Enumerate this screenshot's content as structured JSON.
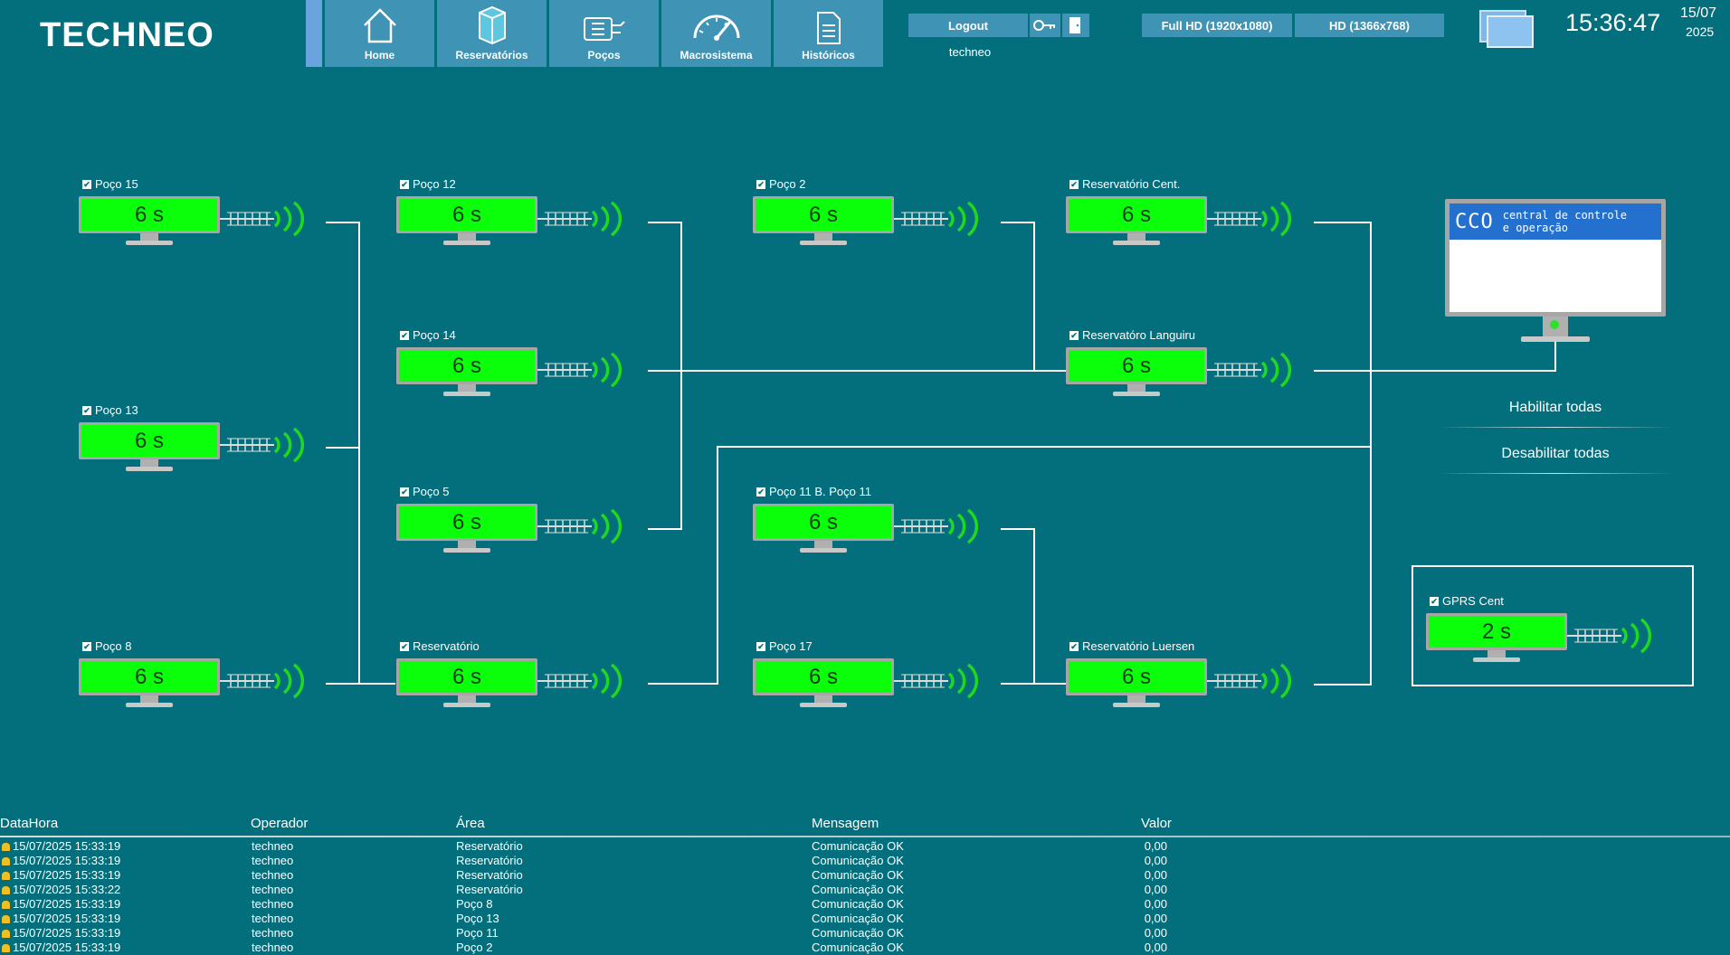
{
  "app": {
    "logo": "TECHNEO"
  },
  "nav": [
    {
      "label": "Home",
      "icon": "home-icon"
    },
    {
      "label": "Reservatórios",
      "icon": "tank-icon"
    },
    {
      "label": "Poços",
      "icon": "pump-icon"
    },
    {
      "label": "Macrosistema",
      "icon": "gauge-icon"
    },
    {
      "label": "Históricos",
      "icon": "document-icon"
    }
  ],
  "header": {
    "logout_label": "Logout",
    "user": "techneo",
    "res_full_hd": "Full HD (1920x1080)",
    "res_hd": "HD (1366x768)",
    "time": "15:36:47",
    "date_day": "15/07",
    "date_year": "2025"
  },
  "nodes": [
    {
      "name": "Poço 15",
      "value": "6 s"
    },
    {
      "name": "Poço 13",
      "value": "6 s"
    },
    {
      "name": "Poço 8",
      "value": "6 s"
    },
    {
      "name": "Poço 12",
      "value": "6 s"
    },
    {
      "name": "Poço 14",
      "value": "6 s"
    },
    {
      "name": "Poço 5",
      "value": "6 s"
    },
    {
      "name": "Reservatório",
      "value": "6 s"
    },
    {
      "name": "Poço 2",
      "value": "6 s"
    },
    {
      "name": "Poço 11 B. Poço 11",
      "value": "6 s"
    },
    {
      "name": "Poço 17",
      "value": "6 s"
    },
    {
      "name": "Reservatório Cent.",
      "value": "6 s"
    },
    {
      "name": "Reservatóro Languiru",
      "value": "6 s"
    },
    {
      "name": "Reservatório Luersen",
      "value": "6 s"
    },
    {
      "name": "GPRS Cent",
      "value": "2 s"
    }
  ],
  "cco": {
    "logo": "CCO",
    "caption": "central de controle e operação"
  },
  "actions": {
    "enable_all": "Habilitar todas",
    "disable_all": "Desabilitar todas"
  },
  "log": {
    "columns": [
      "DataHora",
      "Operador",
      "Área",
      "Mensagem",
      "Valor"
    ],
    "rows": [
      {
        "datetime": "15/07/2025 15:33:19",
        "operator": "techneo",
        "area": "Reservatório",
        "message": "Comunicação OK",
        "value": "0,00"
      },
      {
        "datetime": "15/07/2025 15:33:19",
        "operator": "techneo",
        "area": "Reservatório",
        "message": "Comunicação OK",
        "value": "0,00"
      },
      {
        "datetime": "15/07/2025 15:33:19",
        "operator": "techneo",
        "area": "Reservatório",
        "message": "Comunicação OK",
        "value": "0,00"
      },
      {
        "datetime": "15/07/2025 15:33:22",
        "operator": "techneo",
        "area": "Reservatório",
        "message": "Comunicação OK",
        "value": "0,00"
      },
      {
        "datetime": "15/07/2025 15:33:19",
        "operator": "techneo",
        "area": "Poço 8",
        "message": "Comunicação OK",
        "value": "0,00"
      },
      {
        "datetime": "15/07/2025 15:33:19",
        "operator": "techneo",
        "area": "Poço 13",
        "message": "Comunicação OK",
        "value": "0,00"
      },
      {
        "datetime": "15/07/2025 15:33:19",
        "operator": "techneo",
        "area": "Poço 11",
        "message": "Comunicação OK",
        "value": "0,00"
      },
      {
        "datetime": "15/07/2025 15:33:19",
        "operator": "techneo",
        "area": "Poço 2",
        "message": "Comunicação OK",
        "value": "0,00"
      }
    ]
  }
}
